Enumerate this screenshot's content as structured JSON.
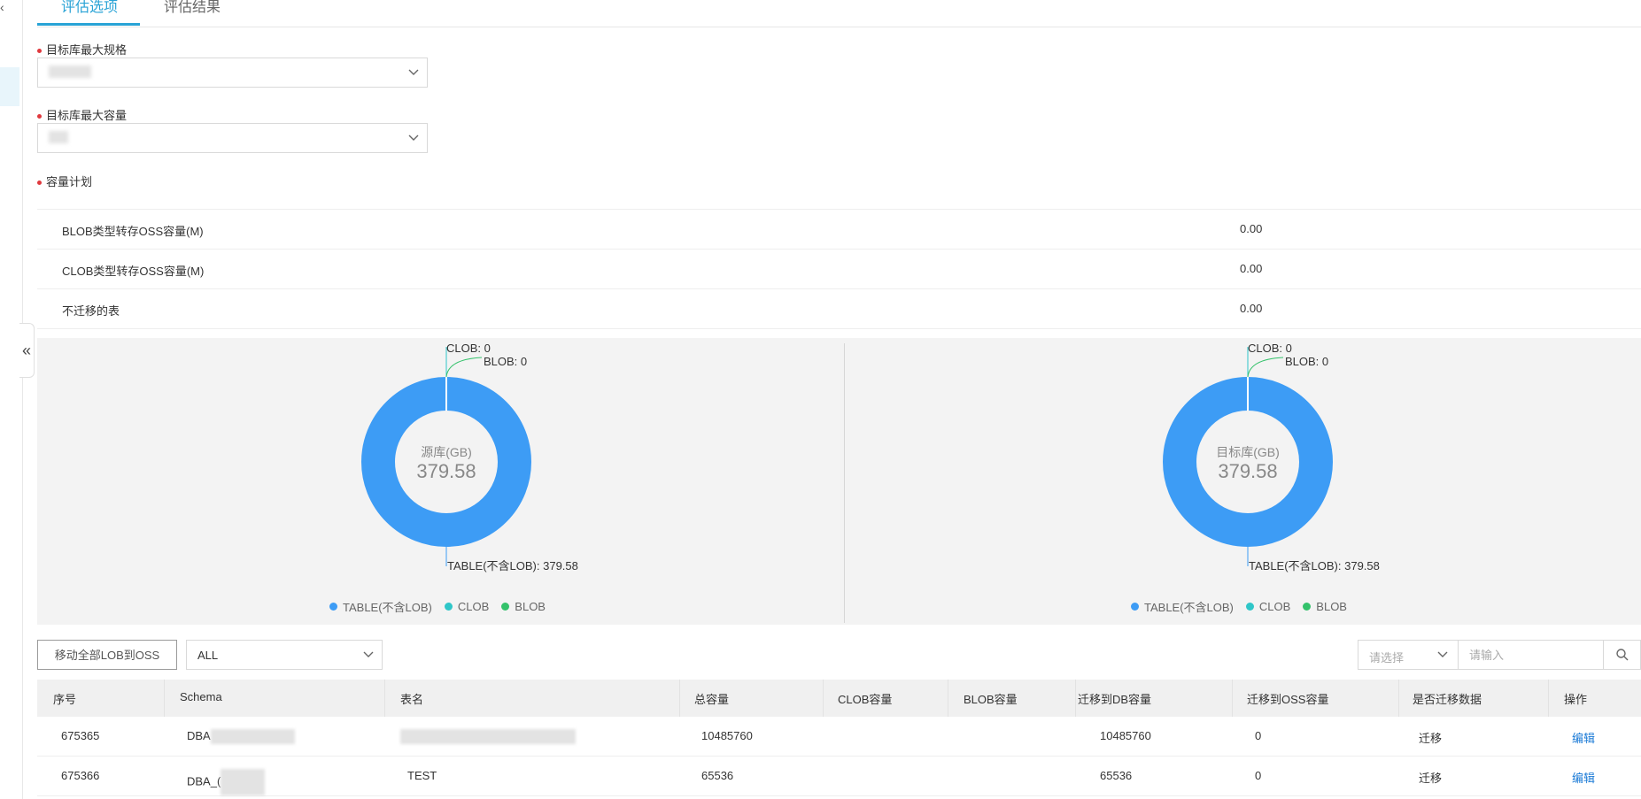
{
  "tabs": [
    {
      "label": "评估选项",
      "active": true
    },
    {
      "label": "评估结果",
      "active": false
    }
  ],
  "form": {
    "max_spec_label": "目标库最大规格",
    "max_capacity_label": "目标库最大容量",
    "capacity_plan_label": "容量计划"
  },
  "capacity_rows": [
    {
      "label": "BLOB类型转存OSS容量(M)",
      "value": "0.00"
    },
    {
      "label": "CLOB类型转存OSS容量(M)",
      "value": "0.00"
    },
    {
      "label": "不迁移的表",
      "value": "0.00"
    }
  ],
  "chart_data": [
    {
      "type": "pie",
      "center_title": "源库(GB)",
      "center_value": "379.58",
      "slices": [
        {
          "name": "TABLE(不含LOB)",
          "value": 379.58,
          "label": "TABLE(不含LOB): 379.58",
          "color": "#3d9cf5"
        },
        {
          "name": "CLOB",
          "value": 0,
          "label": "CLOB: 0",
          "color": "#2fc6c8"
        },
        {
          "name": "BLOB",
          "value": 0,
          "label": "BLOB: 0",
          "color": "#34c26b"
        }
      ]
    },
    {
      "type": "pie",
      "center_title": "目标库(GB)",
      "center_value": "379.58",
      "slices": [
        {
          "name": "TABLE(不含LOB)",
          "value": 379.58,
          "label": "TABLE(不含LOB): 379.58",
          "color": "#3d9cf5"
        },
        {
          "name": "CLOB",
          "value": 0,
          "label": "CLOB: 0",
          "color": "#2fc6c8"
        },
        {
          "name": "BLOB",
          "value": 0,
          "label": "BLOB: 0",
          "color": "#34c26b"
        }
      ]
    }
  ],
  "toolbar": {
    "move_lob_label": "移动全部LOB到OSS",
    "filter_value": "ALL",
    "search_select_placeholder": "请选择",
    "search_input_placeholder": "请输入"
  },
  "table": {
    "columns": [
      "序号",
      "Schema",
      "表名",
      "总容量",
      "CLOB容量",
      "BLOB容量",
      "迁移到DB容量",
      "迁移到OSS容量",
      "是否迁移数据",
      "操作"
    ],
    "rows": [
      {
        "id": "675365",
        "schema": "DBA",
        "table": "",
        "total": "10485760",
        "clob": "",
        "blob": "",
        "db": "10485760",
        "oss": "0",
        "migrate": "迁移",
        "action": "编辑"
      },
      {
        "id": "675366",
        "schema": "DBA_(",
        "table": "TEST",
        "total": "65536",
        "clob": "",
        "blob": "",
        "db": "65536",
        "oss": "0",
        "migrate": "迁移",
        "action": "编辑"
      }
    ]
  }
}
